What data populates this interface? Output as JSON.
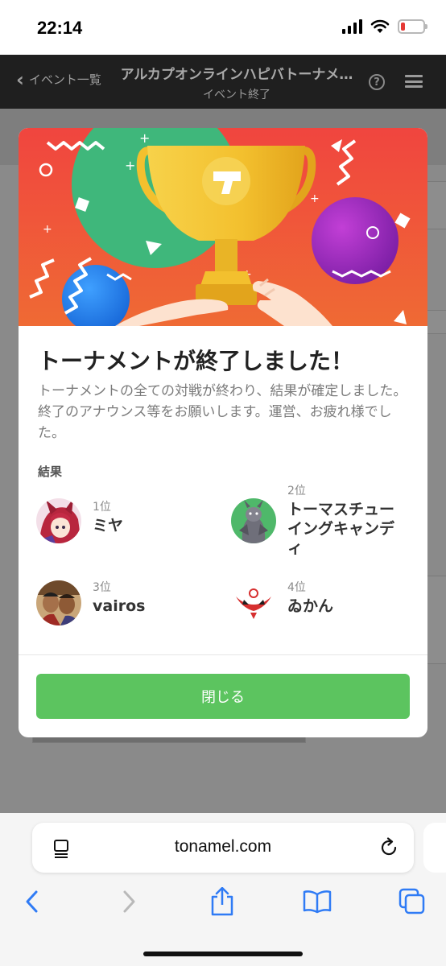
{
  "status_bar": {
    "time": "22:14"
  },
  "nav": {
    "back_label": "イベント一覧",
    "title": "アルカプオンラインハピバトーナメ…",
    "subtitle": "イベント終了",
    "help_symbol": "?"
  },
  "modal": {
    "title": "トーナメントが終了しました！",
    "description": "トーナメントの全ての対戦が終わり、結果が確定しました。終了のアナウンス等をお願いします。運営、お疲れ様でした。",
    "results_label": "結果",
    "results": [
      {
        "position": "1位",
        "name": "ミヤ"
      },
      {
        "position": "2位",
        "name": "トーマスチューイングキャンディ"
      },
      {
        "position": "3位",
        "name": "vairos"
      },
      {
        "position": "4位",
        "name": "ゐかん"
      }
    ],
    "close_label": "閉じる"
  },
  "browser": {
    "url": "tonamel.com"
  },
  "colors": {
    "accent_green": "#5cc45f",
    "hero_red": "#ec4a3b",
    "nav_dark": "#1f1f1f",
    "trophy_gold": "#f3c433"
  }
}
